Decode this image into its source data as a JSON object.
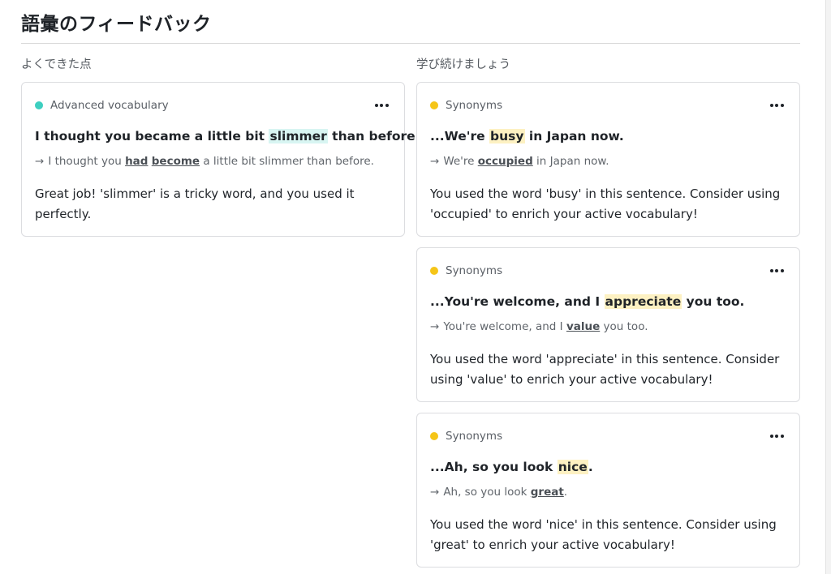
{
  "page": {
    "title": "語彙のフィードバック"
  },
  "left": {
    "heading": "よくできた点",
    "cards": [
      {
        "category": "Advanced vocabulary",
        "dot_color": "#3ecfc0",
        "sentence": {
          "pre": "I thought you became a little bit ",
          "hl": "slimmer",
          "post": " than before."
        },
        "suggestion": {
          "p1": "I thought you ",
          "u1": "had",
          "p2": " ",
          "u2": "become",
          "p3": " a little bit slimmer than before."
        },
        "feedback": "Great job! 'slimmer' is a tricky word, and you used it perfectly."
      }
    ]
  },
  "right": {
    "heading": "学び続けましょう",
    "cards": [
      {
        "category": "Synonyms",
        "dot_color": "#f5c518",
        "sentence": {
          "pre": "...We're ",
          "hl": "busy",
          "post": " in Japan now."
        },
        "suggestion": {
          "pre": "We're ",
          "u": "occupied",
          "post": " in Japan now."
        },
        "feedback": "You used the word 'busy' in this sentence. Consider using 'occupied' to enrich your active vocabulary!"
      },
      {
        "category": "Synonyms",
        "dot_color": "#f5c518",
        "sentence": {
          "pre": "...You're welcome, and I ",
          "hl": "appreciate",
          "post": " you too."
        },
        "suggestion": {
          "pre": "You're welcome, and I ",
          "u": "value",
          "post": " you too."
        },
        "feedback": "You used the word 'appreciate' in this sentence. Consider using 'value' to enrich your active vocabulary!"
      },
      {
        "category": "Synonyms",
        "dot_color": "#f5c518",
        "sentence": {
          "pre": "...Ah, so you look ",
          "hl": "nice",
          "post": "."
        },
        "suggestion": {
          "pre": "Ah, so you look ",
          "u": "great",
          "post": "."
        },
        "feedback": "You used the word 'nice' in this sentence. Consider using 'great' to enrich your active vocabulary!"
      }
    ]
  },
  "icons": {
    "more": "more-horizontal-icon",
    "arrow": "arrow-right-icon",
    "arrow_glyph": "→"
  }
}
